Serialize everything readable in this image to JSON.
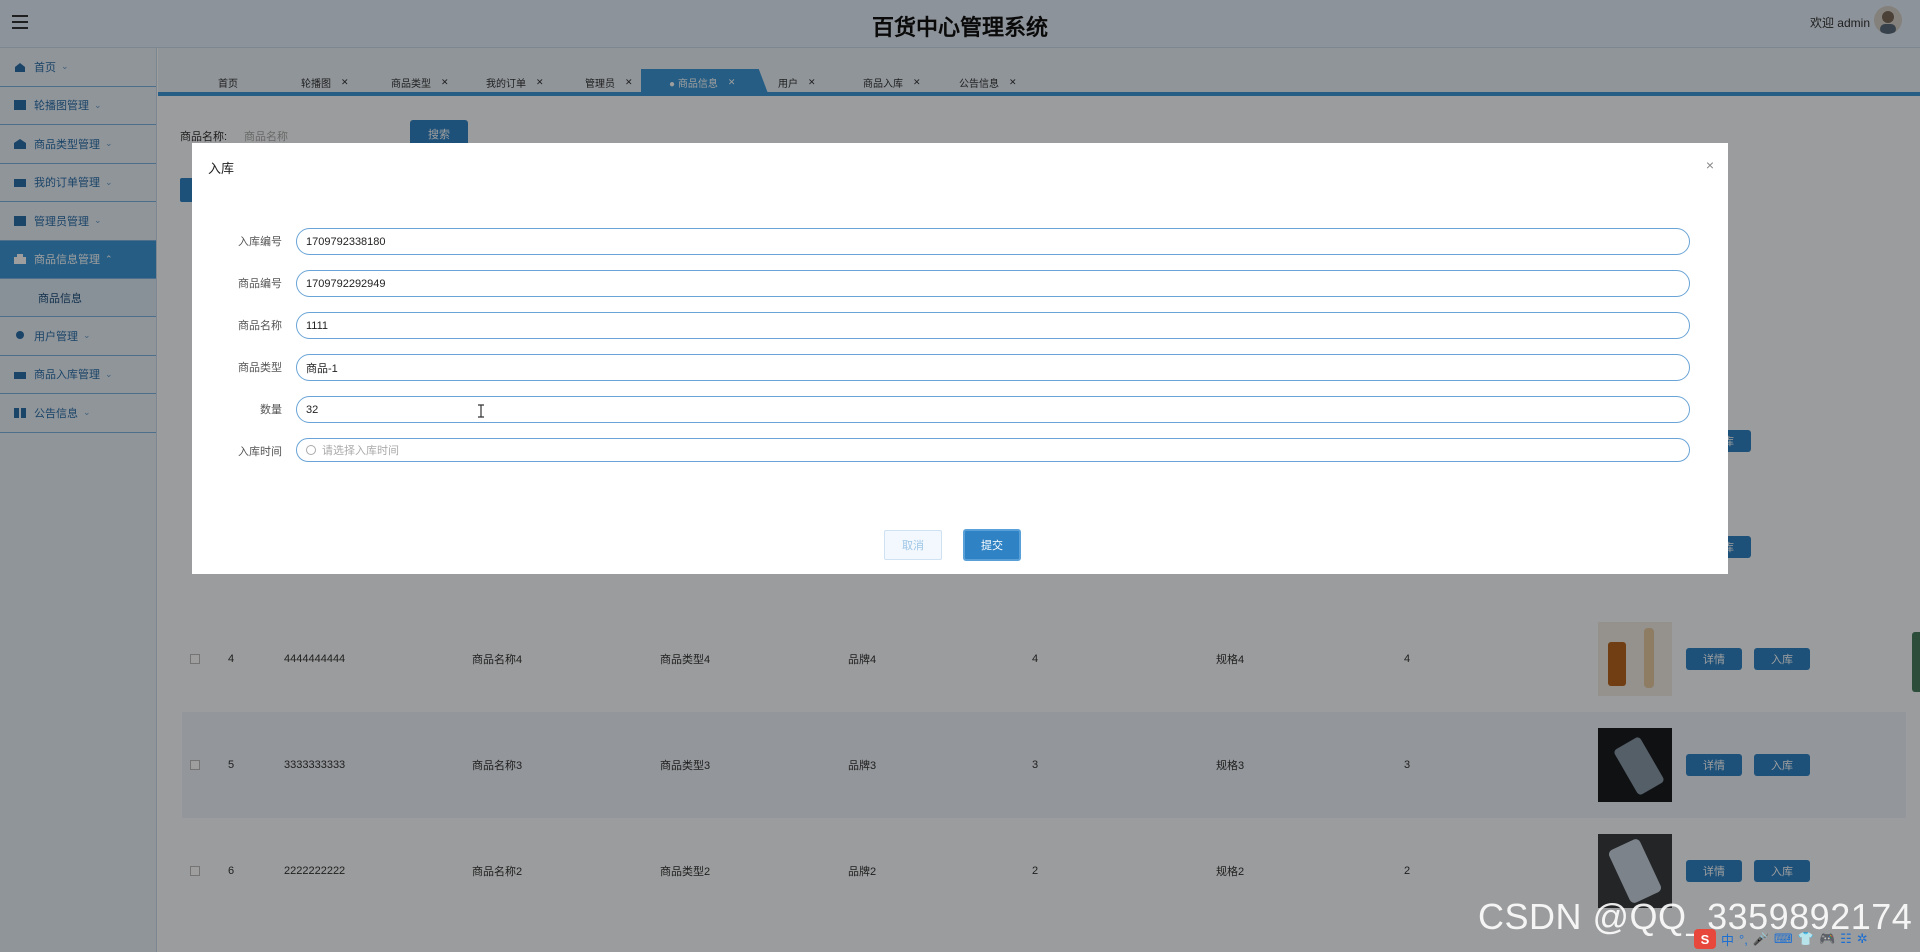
{
  "app": {
    "title": "百货中心管理系统",
    "welcome": "欢迎 admin"
  },
  "sidebar": {
    "items": [
      {
        "label": "首页",
        "icon": "home-icon"
      },
      {
        "label": "轮播图管理",
        "icon": "carousel-icon"
      },
      {
        "label": "商品类型管理",
        "icon": "category-icon"
      },
      {
        "label": "我的订单管理",
        "icon": "order-icon"
      },
      {
        "label": "管理员管理",
        "icon": "admin-icon"
      },
      {
        "label": "商品信息管理",
        "icon": "product-icon",
        "active": true
      },
      {
        "label": "用户管理",
        "icon": "user-icon"
      },
      {
        "label": "商品入库管理",
        "icon": "stock-in-icon"
      },
      {
        "label": "公告信息",
        "icon": "notice-icon"
      }
    ],
    "subitem": "商品信息"
  },
  "tabs": [
    {
      "label": "首页",
      "closable": false
    },
    {
      "label": "轮播图",
      "closable": true
    },
    {
      "label": "商品类型",
      "closable": true
    },
    {
      "label": "我的订单",
      "closable": true
    },
    {
      "label": "管理员",
      "closable": true
    },
    {
      "label": "● 商品信息",
      "closable": true,
      "active": true
    },
    {
      "label": "用户",
      "closable": true
    },
    {
      "label": "商品入库",
      "closable": true
    },
    {
      "label": "公告信息",
      "closable": true
    }
  ],
  "search": {
    "label": "商品名称:",
    "placeholder": "商品名称",
    "button": "搜索"
  },
  "table": {
    "rows": [
      {
        "index": "4",
        "code": "4444444444",
        "name": "商品名称4",
        "type": "商品类型4",
        "brand": "品牌4",
        "qty": "4",
        "spec": "规格4",
        "stock": "4",
        "detail": "详情",
        "stock_in": "入库"
      },
      {
        "index": "5",
        "code": "3333333333",
        "name": "商品名称3",
        "type": "商品类型3",
        "brand": "品牌3",
        "qty": "3",
        "spec": "规格3",
        "stock": "3",
        "detail": "详情",
        "stock_in": "入库"
      },
      {
        "index": "6",
        "code": "2222222222",
        "name": "商品名称2",
        "type": "商品类型2",
        "brand": "品牌2",
        "qty": "2",
        "spec": "规格2",
        "stock": "2",
        "detail": "详情",
        "stock_in": "入库"
      }
    ],
    "hidden_row_button": "入库"
  },
  "modal": {
    "title": "入库",
    "close": "×",
    "fields": [
      {
        "label": "入库编号",
        "value": "1709792338180"
      },
      {
        "label": "商品编号",
        "value": "1709792292949"
      },
      {
        "label": "商品名称",
        "value": "1111"
      },
      {
        "label": "商品类型",
        "value": "商品-1"
      },
      {
        "label": "数量",
        "value": "32"
      },
      {
        "label": "入库时间",
        "value": "",
        "placeholder": "请选择入库时间"
      }
    ],
    "cancel": "取消",
    "submit": "提交"
  },
  "watermark": "CSDN @QQ_3359892174",
  "ime": [
    "S",
    "中",
    "°,",
    "🎤",
    "⌨",
    "👕",
    "🎮",
    "☷",
    "✲"
  ],
  "colors": {
    "primary": "#2f83c5",
    "tab_active": "#3d96d6",
    "overlay": "rgba(0,0,0,0.38)"
  }
}
